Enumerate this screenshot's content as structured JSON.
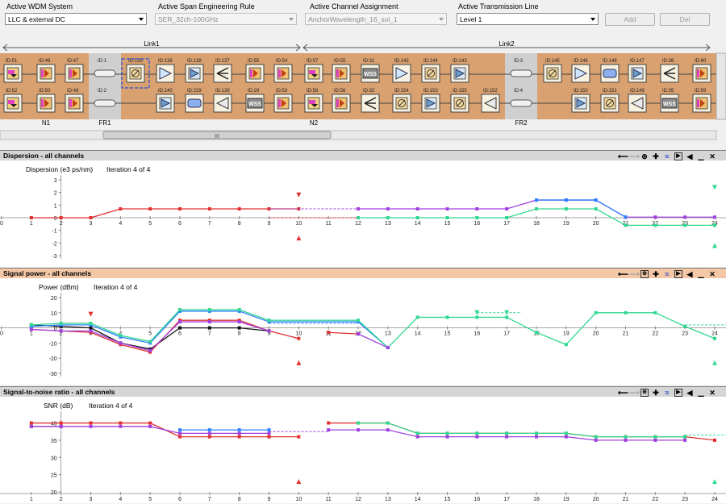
{
  "toolbar": {
    "wdm_label": "Active WDM System",
    "wdm_value": "LLC & external DC",
    "span_label": "Active Span Engineering Rule",
    "span_value": "SER_32ch-100GHz",
    "channel_label": "Active Channel Assignment",
    "channel_value": "AnchorWavelength_16_sol_1",
    "line_label": "Active Transmission Line",
    "line_value": "Level 1",
    "add_label": "Add",
    "del_label": "Del"
  },
  "network": {
    "link1_label": "Link1",
    "link2_label": "Link2",
    "site_labels": [
      "N1",
      "FR1",
      "N2",
      "FR2"
    ],
    "scroll_grip": "III",
    "colors": {
      "site_bg": "#d9a070",
      "fr_bg": "#cfcfcf",
      "amp": "#6aa0d0",
      "dev": "#f5d89a",
      "wss": "#8a8a8a"
    },
    "top_row": [
      {
        "id": "ID:51",
        "icon": "demux-icon"
      },
      {
        "id": "ID:49",
        "icon": "filter-icon"
      },
      {
        "id": "ID:47",
        "icon": "filter-icon"
      },
      {
        "id": "ID:1",
        "icon": "fiber-icon"
      },
      {
        "id": "ID:135",
        "icon": "attenuator-icon",
        "selected": true
      },
      {
        "id": "ID:136",
        "icon": "amplifier-icon"
      },
      {
        "id": "ID:138",
        "icon": "booster-icon"
      },
      {
        "id": "ID:137",
        "icon": "splitter-icon"
      },
      {
        "id": "ID:55",
        "icon": "filter-icon"
      },
      {
        "id": "ID:54",
        "icon": "filter-icon"
      },
      {
        "id": "ID:57",
        "icon": "demux-icon"
      },
      {
        "id": "ID:55",
        "icon": "filter-icon"
      },
      {
        "id": "ID:31",
        "icon": "wss-icon"
      },
      {
        "id": "ID:142",
        "icon": "amplifier-icon"
      },
      {
        "id": "ID:144",
        "icon": "attenuator-icon"
      },
      {
        "id": "ID:143",
        "icon": "booster-icon"
      },
      {
        "id": "ID:3",
        "icon": "fiber-icon"
      },
      {
        "id": "ID:145",
        "icon": "attenuator-icon"
      },
      {
        "id": "ID:146",
        "icon": "amplifier-icon"
      },
      {
        "id": "ID:148",
        "icon": "dcm-icon"
      },
      {
        "id": "ID:147",
        "icon": "booster-icon"
      },
      {
        "id": "ID:36",
        "icon": "splitter-icon"
      },
      {
        "id": "ID:60",
        "icon": "filter-icon"
      }
    ],
    "bottom_row": [
      {
        "id": "ID:52",
        "icon": "demux-icon"
      },
      {
        "id": "ID:50",
        "icon": "filter-icon"
      },
      {
        "id": "ID:48",
        "icon": "filter-icon"
      },
      {
        "id": "ID:2",
        "icon": "fiber-icon"
      },
      {
        "id": "ID:140",
        "icon": "booster-icon"
      },
      {
        "id": "ID:229",
        "icon": "dcm-icon"
      },
      {
        "id": "ID:139",
        "icon": "preamp-icon"
      },
      {
        "id": "ID:29",
        "icon": "wss-icon"
      },
      {
        "id": "ID:53",
        "icon": "filter-icon"
      },
      {
        "id": "ID:58",
        "icon": "demux-icon"
      },
      {
        "id": "ID:56",
        "icon": "filter-icon"
      },
      {
        "id": "ID:32",
        "icon": "splitter-icon"
      },
      {
        "id": "ID:154",
        "icon": "attenuator-icon"
      },
      {
        "id": "ID:153",
        "icon": "booster-icon"
      },
      {
        "id": "ID:155",
        "icon": "attenuator-icon"
      },
      {
        "id": "ID:152",
        "icon": "preamp-icon"
      },
      {
        "id": "ID:4",
        "icon": "fiber-icon"
      },
      {
        "id": "ID:150",
        "icon": "booster-icon"
      },
      {
        "id": "ID:151",
        "icon": "attenuator-icon"
      },
      {
        "id": "ID:149",
        "icon": "preamp-icon"
      },
      {
        "id": "ID:35",
        "icon": "wss-icon"
      },
      {
        "id": "ID:59",
        "icon": "filter-icon"
      }
    ]
  },
  "panels": {
    "dispersion": {
      "title": "Dispersion - all channels",
      "ylabel": "Dispersion (e3 ps/nm)",
      "iteration": "Iteration 4 of 4"
    },
    "power": {
      "title": "Signal power - all channels",
      "ylabel": "Power (dBm)",
      "iteration": "Iteration 4 of 4"
    },
    "snr": {
      "title": "Signal-to-noise ratio - all channels",
      "ylabel": "SNR (dB)",
      "iteration": "Iteration 4 of 4"
    }
  },
  "chart_data": [
    {
      "type": "line",
      "title": "Dispersion - all channels",
      "ylabel": "Dispersion (e3 ps/nm)",
      "xlim": [
        0,
        24
      ],
      "ylim": [
        -3,
        3
      ],
      "xticks": [
        0,
        1,
        2,
        3,
        4,
        5,
        6,
        7,
        8,
        9,
        10,
        11,
        12,
        13,
        14,
        15,
        16,
        17,
        18,
        19,
        20,
        21,
        22,
        23,
        24
      ],
      "yticks": [
        -3,
        -2,
        -1,
        0,
        1,
        2,
        3
      ],
      "series": [
        {
          "color": "#e03030",
          "x": [
            1,
            2,
            3,
            4,
            5,
            6,
            7,
            8,
            9,
            10
          ],
          "y": [
            0,
            0,
            0,
            0.7,
            0.7,
            0.7,
            0.7,
            0.7,
            0.7,
            0.7
          ]
        },
        {
          "color": "#a040e0",
          "x": [
            12,
            13,
            14,
            15,
            16,
            17,
            18,
            19,
            20,
            21,
            22,
            23,
            24
          ],
          "y": [
            0.7,
            0.7,
            0.7,
            0.7,
            0.7,
            0.7,
            1.4,
            1.4,
            1.4,
            0.05,
            0.05,
            0.05,
            0.05
          ]
        },
        {
          "color": "#3080ff",
          "x": [
            18,
            19,
            20,
            21
          ],
          "y": [
            1.4,
            1.4,
            1.4,
            0.05
          ]
        },
        {
          "color": "#30d890",
          "x": [
            12,
            13,
            14,
            15,
            16,
            17,
            18,
            19,
            20,
            21,
            22,
            23,
            24
          ],
          "y": [
            0,
            0,
            0,
            0,
            0,
            0,
            0.7,
            0.7,
            0.7,
            -0.6,
            -0.6,
            -0.6,
            -0.6
          ]
        }
      ],
      "dashed": [
        {
          "color": "#e03030",
          "x": [
            9,
            12
          ],
          "y": [
            0,
            0
          ]
        },
        {
          "color": "#a040e0",
          "x": [
            9,
            12
          ],
          "y": [
            0.7,
            0.7
          ]
        },
        {
          "color": "#30d890",
          "x": [
            12,
            17
          ],
          "y": [
            0,
            0
          ]
        }
      ],
      "markers": [
        {
          "shape": "tri-down",
          "color": "#e03030",
          "x": 10,
          "y": 1.8
        },
        {
          "shape": "tri-up",
          "color": "#e03030",
          "x": 10,
          "y": -1.6
        },
        {
          "shape": "tri-down",
          "color": "#30d890",
          "x": 24,
          "y": 2.4
        },
        {
          "shape": "tri-up",
          "color": "#30d890",
          "x": 24,
          "y": -2.2
        }
      ]
    },
    {
      "type": "line",
      "title": "Signal power - all channels",
      "ylabel": "Power (dBm)",
      "xlim": [
        0,
        24
      ],
      "ylim": [
        -30,
        20
      ],
      "xticks": [
        0,
        1,
        2,
        3,
        4,
        5,
        6,
        7,
        8,
        9,
        10,
        11,
        12,
        13,
        14,
        15,
        16,
        17,
        18,
        19,
        20,
        21,
        22,
        23,
        24
      ],
      "yticks": [
        -30,
        -20,
        -10,
        0,
        10,
        20
      ],
      "series": [
        {
          "color": "#111111",
          "x": [
            1,
            2,
            3,
            4,
            5,
            6,
            7,
            8,
            9
          ],
          "y": [
            2,
            1,
            0,
            -10,
            -14,
            0,
            0,
            0,
            -2
          ]
        },
        {
          "color": "#e03030",
          "x": [
            1,
            2,
            3,
            4,
            5,
            6,
            7,
            8,
            9,
            10
          ],
          "y": [
            -1,
            -2,
            -3,
            -11,
            -16,
            5,
            5,
            5,
            -2,
            -7
          ]
        },
        {
          "color": "#a040e0",
          "x": [
            1,
            2,
            3,
            4,
            5,
            6,
            7,
            8,
            9
          ],
          "y": [
            -1,
            -2,
            -2,
            -10,
            -15,
            4,
            4,
            4,
            -2
          ]
        },
        {
          "color": "#3080ff",
          "x": [
            1,
            2,
            3,
            4,
            5,
            6,
            7,
            8,
            9,
            12,
            13
          ],
          "y": [
            1,
            2,
            2,
            -6,
            -10,
            11,
            11,
            11,
            4,
            4,
            -13
          ]
        },
        {
          "color": "#30d890",
          "x": [
            1,
            2,
            3,
            4,
            5,
            6,
            7,
            8,
            9,
            12,
            13,
            14,
            15,
            16,
            17,
            18,
            19,
            20,
            21,
            22,
            23,
            24
          ],
          "y": [
            2,
            3,
            3,
            -5,
            -9,
            12,
            12,
            12,
            5,
            5,
            -13,
            7,
            7,
            7,
            7,
            -3,
            -11,
            10,
            10,
            10,
            1,
            -7
          ]
        },
        {
          "color": "#e03030",
          "x": [
            11,
            12
          ],
          "y": [
            -3,
            -4
          ]
        },
        {
          "color": "#a040e0",
          "x": [
            12,
            13
          ],
          "y": [
            -4,
            -13
          ]
        }
      ],
      "dashed": [
        {
          "color": "#3080ff",
          "x": [
            9,
            12
          ],
          "y": [
            3,
            3
          ]
        },
        {
          "color": "#30d890",
          "x": [
            23,
            24.5
          ],
          "y": [
            2,
            2
          ]
        },
        {
          "color": "#30d890",
          "x": [
            16,
            17.5
          ],
          "y": [
            10,
            10
          ]
        }
      ],
      "markers": [
        {
          "shape": "tri-down",
          "color": "#e03030",
          "x": 3,
          "y": 9
        },
        {
          "shape": "tri-up",
          "color": "#e03030",
          "x": 10,
          "y": -23
        },
        {
          "shape": "tri-down",
          "color": "#30d890",
          "x": 16,
          "y": 10
        },
        {
          "shape": "tri-down",
          "color": "#30d890",
          "x": 17,
          "y": 10
        },
        {
          "shape": "tri-up",
          "color": "#30d890",
          "x": 24,
          "y": -23
        }
      ]
    },
    {
      "type": "line",
      "title": "Signal-to-noise ratio - all channels",
      "ylabel": "SNR (dB)",
      "xlim": [
        0,
        24
      ],
      "ylim": [
        20,
        42
      ],
      "xticks": [
        1,
        2,
        3,
        4,
        5,
        6,
        7,
        8,
        9,
        10,
        11,
        12,
        13,
        14,
        15,
        16,
        17,
        18,
        19,
        20,
        21,
        22,
        23,
        24
      ],
      "yticks": [
        20,
        25,
        30,
        35,
        40
      ],
      "series": [
        {
          "color": "#111111",
          "x": [
            1,
            2
          ],
          "y": [
            39,
            39
          ]
        },
        {
          "color": "#e03030",
          "x": [
            1,
            2,
            3,
            4,
            5,
            6,
            7,
            8,
            9,
            10
          ],
          "y": [
            40,
            40,
            40,
            40,
            40,
            36,
            36,
            36,
            36,
            36
          ]
        },
        {
          "color": "#a040e0",
          "x": [
            1,
            2,
            3,
            4,
            5,
            6,
            7,
            8,
            9
          ],
          "y": [
            39,
            39,
            39,
            39,
            39,
            37,
            37,
            37,
            37
          ]
        },
        {
          "color": "#3080ff",
          "x": [
            6,
            7,
            8,
            9
          ],
          "y": [
            38,
            38,
            38,
            38
          ]
        },
        {
          "color": "#e03030",
          "x": [
            11,
            12,
            13,
            14,
            15,
            16,
            17,
            18,
            19,
            20,
            21,
            22,
            23,
            24
          ],
          "y": [
            40,
            40,
            40,
            37,
            37,
            37,
            37,
            37,
            37,
            36,
            36,
            36,
            36,
            35
          ]
        },
        {
          "color": "#a040e0",
          "x": [
            11,
            12,
            13,
            14,
            15,
            16,
            17,
            18,
            19,
            20,
            21,
            22,
            23
          ],
          "y": [
            38,
            38,
            38,
            36,
            36,
            36,
            36,
            36,
            36,
            35,
            35,
            35,
            35
          ]
        },
        {
          "color": "#30d890",
          "x": [
            12,
            13,
            14,
            15,
            16,
            17,
            18,
            19,
            20,
            21,
            22,
            23
          ],
          "y": [
            40,
            40,
            37,
            37,
            37,
            37,
            37,
            37,
            36,
            36,
            36,
            36
          ]
        }
      ],
      "dashed": [
        {
          "color": "#a040e0",
          "x": [
            9,
            11
          ],
          "y": [
            37.5,
            37.5
          ]
        },
        {
          "color": "#30d890",
          "x": [
            23,
            24.5
          ],
          "y": [
            36.5,
            36.5
          ]
        }
      ],
      "markers": [
        {
          "shape": "tri-up",
          "color": "#e03030",
          "x": 10,
          "y": 23
        },
        {
          "shape": "tri-up",
          "color": "#30d890",
          "x": 24,
          "y": 23
        }
      ]
    }
  ]
}
